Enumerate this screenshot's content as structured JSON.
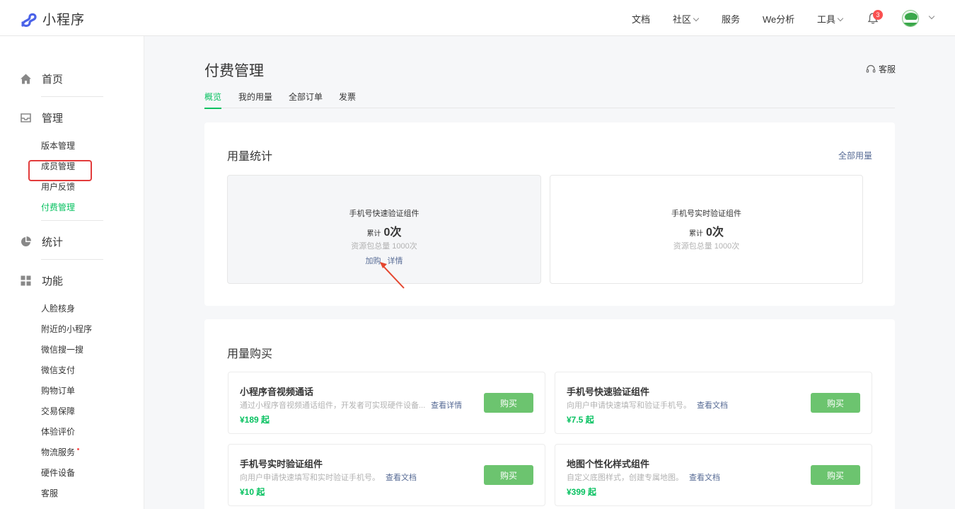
{
  "header": {
    "logo_text": "小程序",
    "nav": [
      {
        "label": "文档",
        "has_dropdown": false
      },
      {
        "label": "社区",
        "has_dropdown": true
      },
      {
        "label": "服务",
        "has_dropdown": false
      },
      {
        "label": "We分析",
        "has_dropdown": false
      },
      {
        "label": "工具",
        "has_dropdown": true
      }
    ],
    "notification_count": "3",
    "accent_color": "#07c160"
  },
  "sidebar": {
    "groups": [
      {
        "label": "首页",
        "icon": "home-icon",
        "items": []
      },
      {
        "label": "管理",
        "icon": "inbox-icon",
        "items": [
          "版本管理",
          "成员管理",
          "用户反馈",
          "付费管理"
        ]
      },
      {
        "label": "统计",
        "icon": "pie-chart-icon",
        "items": []
      },
      {
        "label": "功能",
        "icon": "grid-icon",
        "items": [
          "人脸核身",
          "附近的小程序",
          "微信搜一搜",
          "微信支付",
          "购物订单",
          "交易保障",
          "体验评价",
          "物流服务",
          "硬件设备",
          "客服"
        ]
      }
    ],
    "active_item": "付费管理"
  },
  "page": {
    "title": "付费管理",
    "service_label": "客服",
    "tabs": [
      {
        "label": "概览",
        "active": true
      },
      {
        "label": "我的用量",
        "active": false
      },
      {
        "label": "全部订单",
        "active": false
      },
      {
        "label": "发票",
        "active": false
      }
    ]
  },
  "usage_stats": {
    "title": "用量统计",
    "all_usage_link": "全部用量",
    "total_prefix": "累计",
    "cards": [
      {
        "name": "手机号快速验证组件",
        "total": "0次",
        "pack": "资源包总量 1000次",
        "links": [
          "加购",
          "详情"
        ]
      },
      {
        "name": "手机号实时验证组件",
        "total": "0次",
        "pack": "资源包总量 1000次",
        "links": []
      }
    ]
  },
  "purchase": {
    "title": "用量购买",
    "buy_label": "购买",
    "products": [
      {
        "name": "小程序音视频通话",
        "desc": "通过小程序音视频通话组件，开发者可实现硬件设备...",
        "link": "查看详情",
        "price": "¥189 起"
      },
      {
        "name": "手机号快速验证组件",
        "desc": "向用户申请快速填写和验证手机号。",
        "link": "查看文档",
        "price": "¥7.5 起"
      },
      {
        "name": "手机号实时验证组件",
        "desc": "向用户申请快速填写和实时验证手机号。",
        "link": "查看文档",
        "price": "¥10 起"
      },
      {
        "name": "地图个性化样式组件",
        "desc": "自定义底图样式，创建专属地图。",
        "link": "查看文档",
        "price": "¥399 起"
      }
    ]
  }
}
